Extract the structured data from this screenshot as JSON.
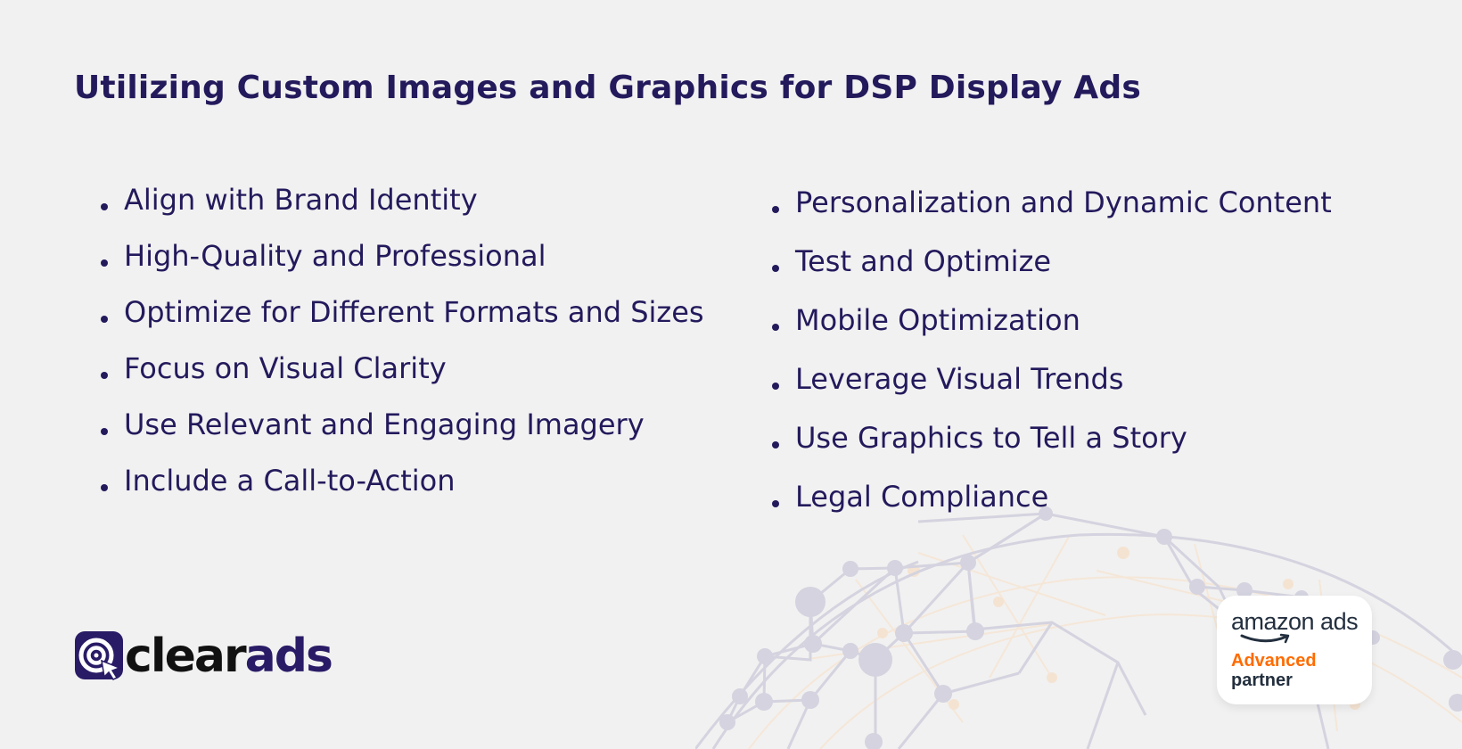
{
  "title": "Utilizing Custom Images and Graphics for DSP Display Ads",
  "left_list": [
    "Align with Brand Identity",
    "High-Quality and Professional",
    "Optimize for Different Formats and Sizes",
    "Focus on Visual Clarity",
    "Use Relevant and Engaging Imagery",
    "Include a Call-to-Action"
  ],
  "right_list": [
    "Personalization and Dynamic Content",
    "Test and Optimize",
    "Mobile Optimization",
    "Leverage Visual Trends",
    "Use Graphics to Tell a Story",
    "Legal Compliance"
  ],
  "logo": {
    "part1": "clear",
    "part2": "ads",
    "icon": "target-cursor-icon"
  },
  "badge": {
    "brand": "amazon ads",
    "level": "Advanced",
    "type": "partner"
  },
  "colors": {
    "primary": "#231a5c",
    "background": "#f1f1f1",
    "accent_orange": "#ff6b00"
  }
}
